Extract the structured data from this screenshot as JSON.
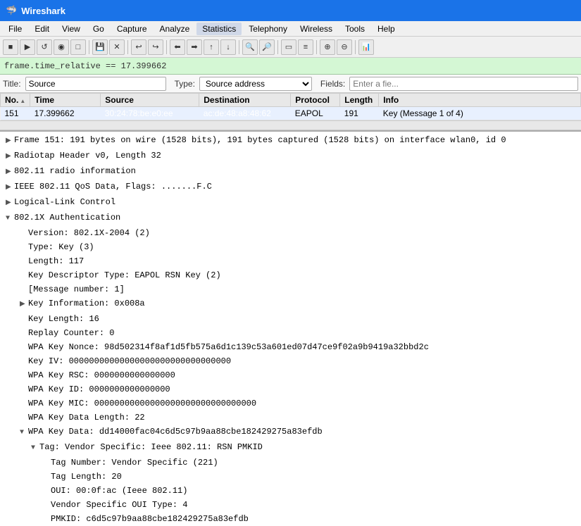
{
  "titlebar": {
    "app_name": "Wireshark",
    "icon": "🦈"
  },
  "menu": {
    "items": [
      "File",
      "Edit",
      "View",
      "Go",
      "Capture",
      "Analyze",
      "Statistics",
      "Telephony",
      "Wireless",
      "Tools",
      "Help"
    ]
  },
  "toolbar": {
    "buttons": [
      "■",
      "▶",
      "↺",
      "◉",
      "□",
      "💾",
      "✕",
      "↩",
      "↪",
      "⬅",
      "➡",
      "⬆",
      "⬇",
      "🔍+",
      "🔍-",
      "⬜",
      "≡",
      "⊕",
      "⊖",
      "📊"
    ]
  },
  "filter_bar": {
    "expression": "frame.time_relative == 17.399662"
  },
  "title_row": {
    "title_label": "Title:",
    "title_value": "Source",
    "type_label": "Type:",
    "type_value": "Source address",
    "fields_label": "Fields:",
    "fields_placeholder": "Enter a fie..."
  },
  "columns": {
    "headers": [
      "No.",
      "Time",
      "Source",
      "Destination",
      "Protocol",
      "Length",
      "Info"
    ],
    "sort_col": "No.",
    "sort_dir": "▲"
  },
  "packets": [
    {
      "no": "151",
      "time": "17.399662",
      "source": "30:24:78:be:e0:ee",
      "destination": "ac:de:48:a8:48:62",
      "protocol": "EAPOL",
      "length": "191",
      "info": "Key (Message 1 of 4)",
      "selected": true
    }
  ],
  "details": [
    {
      "level": 0,
      "expanded": false,
      "text": "Frame 151: 191 bytes on wire (1528 bits), 191 bytes captured (1528 bits) on interface wlan0, id 0",
      "indent": "expandable"
    },
    {
      "level": 0,
      "expanded": false,
      "text": "Radiotap Header v0, Length 32",
      "indent": "expandable"
    },
    {
      "level": 0,
      "expanded": false,
      "text": "802.11 radio information",
      "indent": "expandable"
    },
    {
      "level": 0,
      "expanded": false,
      "text": "IEEE 802.11 QoS Data, Flags: .......F.C",
      "indent": "expandable"
    },
    {
      "level": 0,
      "expanded": false,
      "text": "Logical-Link Control",
      "indent": "expandable"
    },
    {
      "level": 0,
      "expanded": true,
      "text": "802.1X Authentication",
      "indent": "expandable"
    },
    {
      "level": 1,
      "text": "Version: 802.1X-2004 (2)",
      "indent": "sub"
    },
    {
      "level": 1,
      "text": "Type: Key (3)",
      "indent": "sub"
    },
    {
      "level": 1,
      "text": "Length: 117",
      "indent": "sub"
    },
    {
      "level": 1,
      "text": "Key Descriptor Type: EAPOL RSN Key (2)",
      "indent": "sub"
    },
    {
      "level": 1,
      "text": "[Message number: 1]",
      "indent": "sub"
    },
    {
      "level": 1,
      "expanded": false,
      "text": "Key Information: 0x008a",
      "indent": "sub expandable"
    },
    {
      "level": 1,
      "text": "Key Length: 16",
      "indent": "sub"
    },
    {
      "level": 1,
      "text": "Replay Counter: 0",
      "indent": "sub"
    },
    {
      "level": 1,
      "text": "WPA Key Nonce: 98d502314f8af1d5fb575a6d1c139c53a601ed07d47ce9f02a9b9419a32bbd2c",
      "indent": "sub"
    },
    {
      "level": 1,
      "text": "Key IV: 00000000000000000000000000000000",
      "indent": "sub"
    },
    {
      "level": 1,
      "text": "WPA Key RSC: 0000000000000000",
      "indent": "sub"
    },
    {
      "level": 1,
      "text": "WPA Key ID: 0000000000000000",
      "indent": "sub"
    },
    {
      "level": 1,
      "text": "WPA Key MIC: 00000000000000000000000000000000",
      "indent": "sub"
    },
    {
      "level": 1,
      "text": "WPA Key Data Length: 22",
      "indent": "sub"
    },
    {
      "level": 1,
      "expanded": true,
      "text": "WPA Key Data: dd14000fac04c6d5c97b9aa88cbe182429275a83efdb",
      "indent": "sub expandable"
    },
    {
      "level": 2,
      "expanded": true,
      "text": "Tag: Vendor Specific: Ieee 802.11: RSN PMKID",
      "indent": "sub2 expandable"
    },
    {
      "level": 3,
      "text": "Tag Number: Vendor Specific (221)",
      "indent": "sub3"
    },
    {
      "level": 3,
      "text": "Tag Length: 20",
      "indent": "sub3"
    },
    {
      "level": 3,
      "text": "OUI: 00:0f:ac (Ieee 802.11)",
      "indent": "sub3"
    },
    {
      "level": 3,
      "text": "Vendor Specific OUI Type: 4",
      "indent": "sub3"
    },
    {
      "level": 3,
      "text": "PMKID: c6d5c97b9aa88cbe182429275a83efdb",
      "indent": "sub3 highlighted"
    }
  ]
}
